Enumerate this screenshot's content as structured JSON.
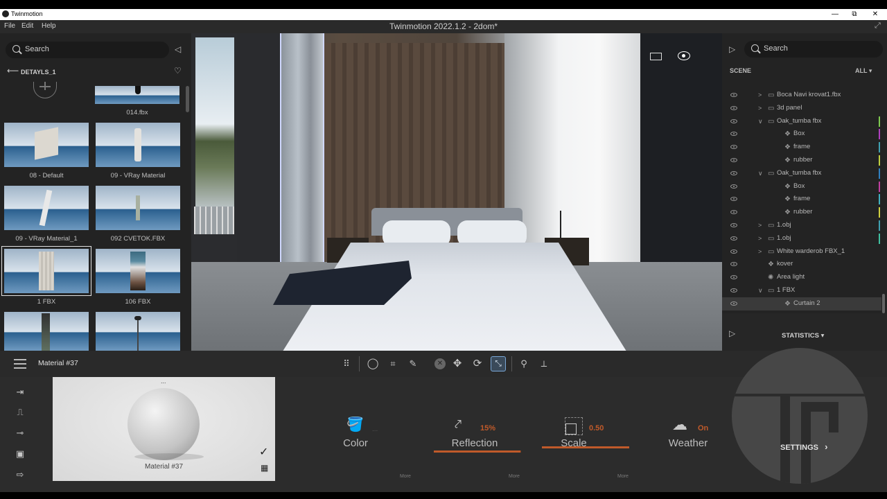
{
  "window": {
    "app_name": "Twinmotion",
    "minimize": "—",
    "restore": "⧉",
    "close": "✕"
  },
  "menu": {
    "file": "File",
    "edit": "Edit",
    "help": "Help",
    "document_title": "Twinmotion 2022.1.2 - 2dom*"
  },
  "library": {
    "search_placeholder": "Search",
    "breadcrumb": "DETAYLS_1",
    "items": [
      {
        "label": "014.fbx"
      },
      {
        "label": "08 - Default"
      },
      {
        "label": "09 - VRay Material"
      },
      {
        "label": "09 - VRay Material_1"
      },
      {
        "label": "092 CVETOK.FBX"
      },
      {
        "label": "1 FBX"
      },
      {
        "label": "106 FBX"
      }
    ]
  },
  "scene": {
    "search_placeholder": "Search",
    "header": "SCENE",
    "filter": "ALL",
    "rows": [
      {
        "label": "Boca Navi krovat1.fbx",
        "type": "folder",
        "indent": 1,
        "expanded": false,
        "bar": ""
      },
      {
        "label": "3d panel",
        "type": "folder",
        "indent": 1,
        "expanded": false,
        "bar": ""
      },
      {
        "label": "Oak_tumba fbx",
        "type": "folder",
        "indent": 1,
        "expanded": true,
        "bar": "#7ec850"
      },
      {
        "label": "Box",
        "type": "mesh",
        "indent": 2,
        "expanded": false,
        "bar": "#b040c0"
      },
      {
        "label": "frame",
        "type": "mesh",
        "indent": 2,
        "expanded": false,
        "bar": "#40a0b0"
      },
      {
        "label": "rubber",
        "type": "mesh",
        "indent": 2,
        "expanded": false,
        "bar": "#c0d040"
      },
      {
        "label": "Oak_tumba fbx",
        "type": "folder",
        "indent": 1,
        "expanded": true,
        "bar": "#3080c0"
      },
      {
        "label": "Box",
        "type": "mesh",
        "indent": 2,
        "expanded": false,
        "bar": "#c040a0"
      },
      {
        "label": "frame",
        "type": "mesh",
        "indent": 2,
        "expanded": false,
        "bar": "#40b0c0"
      },
      {
        "label": "rubber",
        "type": "mesh",
        "indent": 2,
        "expanded": false,
        "bar": "#d0d040"
      },
      {
        "label": "1.obj",
        "type": "folder",
        "indent": 1,
        "expanded": false,
        "bar": "#40a0b0"
      },
      {
        "label": "1.obj",
        "type": "folder",
        "indent": 1,
        "expanded": false,
        "bar": "#40c0a0"
      },
      {
        "label": "White warderob FBX_1",
        "type": "folder",
        "indent": 1,
        "expanded": false,
        "bar": ""
      },
      {
        "label": "kover",
        "type": "mesh",
        "indent": 1,
        "expanded": false,
        "bar": ""
      },
      {
        "label": "Area light",
        "type": "light",
        "indent": 1,
        "expanded": false,
        "bar": ""
      },
      {
        "label": "1 FBX",
        "type": "folder",
        "indent": 1,
        "expanded": true,
        "bar": ""
      },
      {
        "label": "Curtain 2",
        "type": "mesh",
        "indent": 2,
        "expanded": false,
        "bar": "",
        "selected": true
      }
    ],
    "statistics": "STATISTICS"
  },
  "toolbar": {
    "material_name": "Material #37"
  },
  "material": {
    "preview_label": "Material #37",
    "dots": "...",
    "color_label": "Color",
    "color_extra": "...",
    "reflection_label": "Reflection",
    "reflection_value": "15%",
    "reflection_fraction": 0.15,
    "scale_label": "Scale",
    "scale_value": "0.50",
    "weather_label": "Weather",
    "weather_value": "On",
    "more_1": "More",
    "more_2": "More",
    "more_3": "More",
    "settings": "SETTINGS"
  },
  "colors": {
    "accent_orange": "#c05a2a",
    "panel_bg": "#232323",
    "selection": "#3a3a3a"
  }
}
